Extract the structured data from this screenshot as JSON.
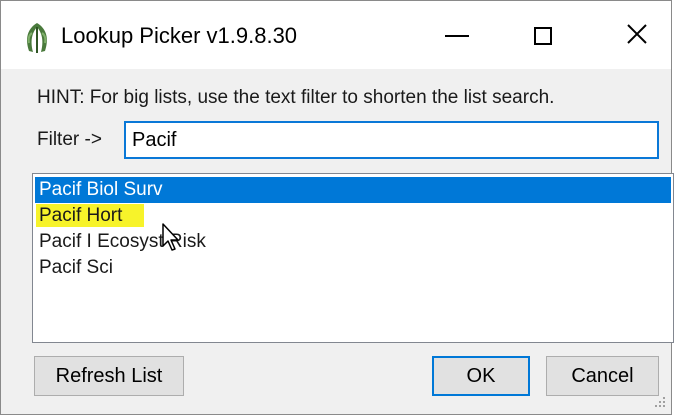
{
  "window": {
    "title": "Lookup Picker v1.9.8.30",
    "app_icon": "leaf-icon"
  },
  "controls": {
    "minimize_icon": "minimize-icon",
    "maximize_icon": "maximize-icon",
    "close_icon": "close-icon"
  },
  "hint": "HINT: For big lists, use the text filter to shorten the list search.",
  "filter": {
    "label": "Filter ->",
    "value": "Pacif"
  },
  "list": {
    "items": [
      "Pacif Biol Surv",
      "Pacif Hort",
      "Pacif I Ecosyst Risk",
      "Pacif Sci"
    ],
    "selected_index": 0,
    "highlighted_index": 1
  },
  "buttons": {
    "refresh_label": "Refresh List",
    "ok_label": "OK",
    "cancel_label": "Cancel"
  },
  "colors": {
    "selection": "#0078d7",
    "highlight": "#f7f32a",
    "focus_border": "#0a78d7"
  }
}
